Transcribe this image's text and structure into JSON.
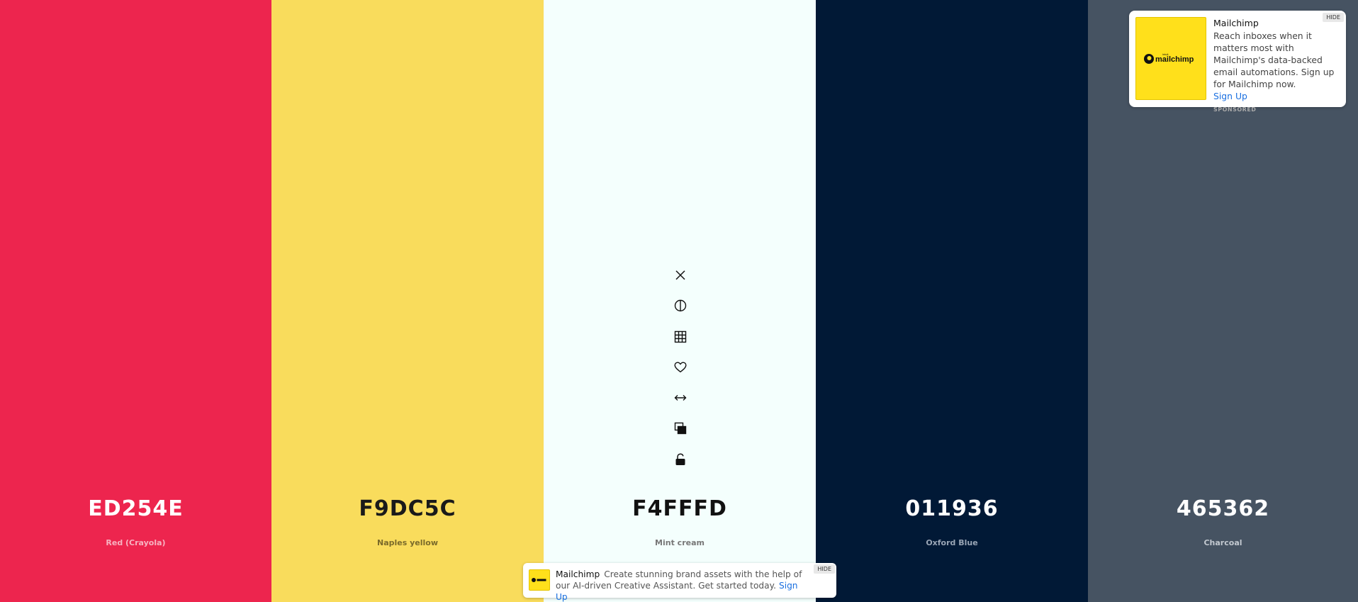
{
  "palette": [
    {
      "hex": "ED254E",
      "name": "Red (Crayola)",
      "bg": "#ED254E",
      "text_color": "#ffffff",
      "name_color": "#f7b3c1"
    },
    {
      "hex": "F9DC5C",
      "name": "Naples yellow",
      "bg": "#F9DC5C",
      "text_color": "#1a1a1a",
      "name_color": "#7a6a2a"
    },
    {
      "hex": "F4FFFD",
      "name": "Mint cream",
      "bg": "#F4FFFD",
      "text_color": "#111111",
      "name_color": "#777777"
    },
    {
      "hex": "011936",
      "name": "Oxford Blue",
      "bg": "#011936",
      "text_color": "#ffffff",
      "name_color": "#9aa6b6"
    },
    {
      "hex": "465362",
      "name": "Charcoal",
      "bg": "#465362",
      "text_color": "#ffffff",
      "name_color": "#c3c9d0"
    }
  ],
  "toolbar": {
    "icons": [
      "close-icon",
      "contrast-icon",
      "grid-icon",
      "heart-icon",
      "resize-horizontal-icon",
      "copy-icon",
      "lock-icon"
    ]
  },
  "ad_top": {
    "brand": "Mailchimp",
    "logo_text": "mailchimp",
    "logo_small": "intuit",
    "text": "Reach inboxes when it matters most with Mailchimp's data-backed email automations. Sign up for Mailchimp now.",
    "cta": "Sign Up",
    "sponsored": "SPONSORED",
    "hide": "HIDE"
  },
  "ad_bottom": {
    "brand": "Mailchimp",
    "text": "Create stunning brand assets with the help of our AI-driven Creative Assistant. Get started today.",
    "cta": "Sign Up",
    "hide": "HIDE"
  }
}
